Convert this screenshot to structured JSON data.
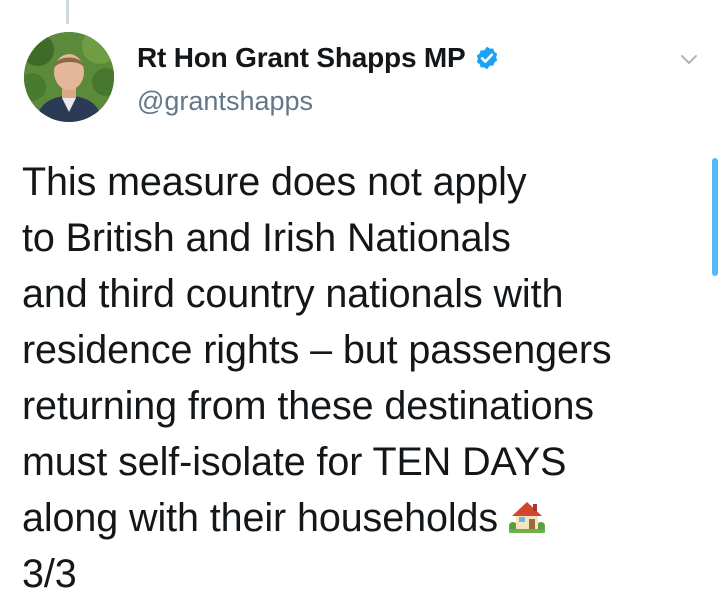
{
  "tweet": {
    "author": {
      "display_name": "Rt Hon Grant Shapps MP",
      "handle": "@grantshapps",
      "verified": true,
      "avatar_icon": "profile-photo"
    },
    "text_lines": [
      "This measure does not apply",
      "to British and Irish Nationals",
      "and third country nationals with",
      "residence rights – but passengers",
      "returning from these destinations",
      "must self-isolate for TEN DAYS",
      "along with their households",
      "3/3"
    ],
    "emoji": "house-with-garden",
    "menu_icon": "chevron-down-icon"
  },
  "colors": {
    "text": "#14171a",
    "secondary": "#657786",
    "verified": "#1da1f2",
    "background": "#ffffff"
  }
}
